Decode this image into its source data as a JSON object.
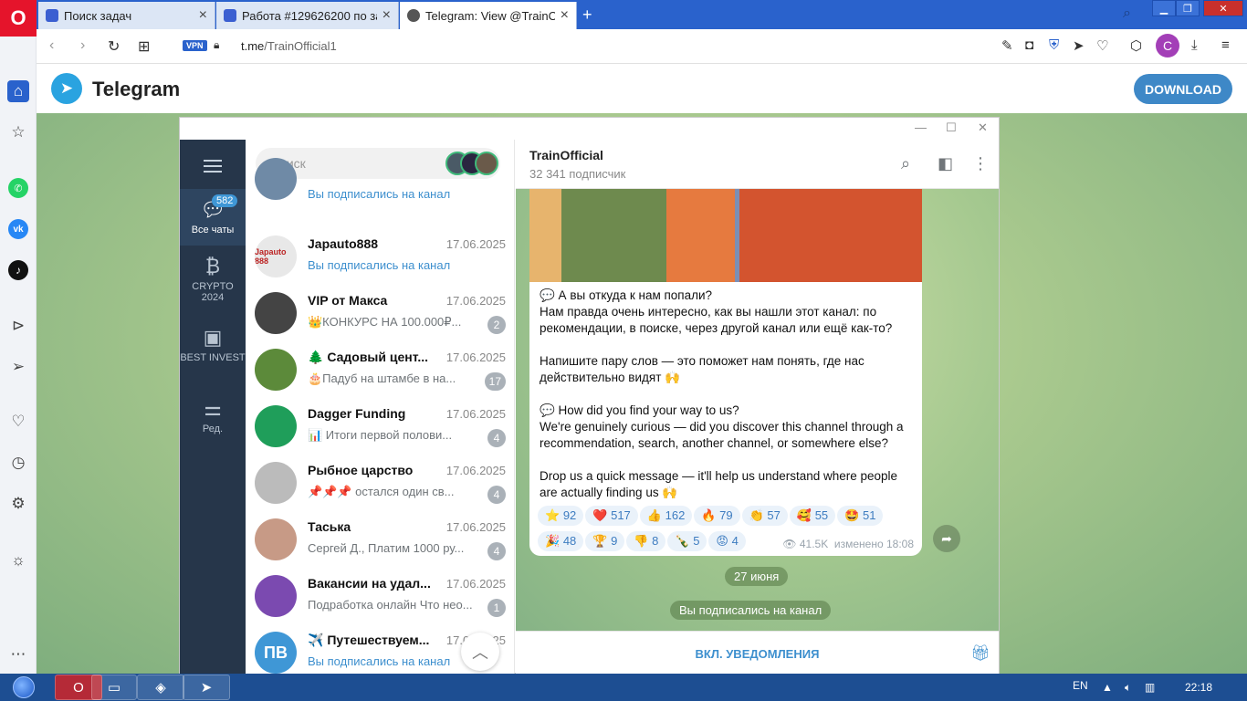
{
  "browser": {
    "tabs": [
      {
        "title": "Поиск задач",
        "active": false
      },
      {
        "title": "Работа #129626200 по зада",
        "active": false
      },
      {
        "title": "Telegram: View @TrainOffici",
        "active": true
      }
    ],
    "vpn_label": "VPN",
    "url_host": "t.me",
    "url_path": "/TrainOfficial1",
    "profile_initial": "C"
  },
  "site": {
    "brand": "Telegram",
    "download_label": "DOWNLOAD"
  },
  "app": {
    "folders": [
      {
        "label": "Все чаты",
        "badge": "582",
        "icon": "chat-bubbles-icon"
      },
      {
        "label": "CRYPTO 2024",
        "icon": "bitcoin-icon"
      },
      {
        "label": "BEST INVEST",
        "icon": "briefcase-icon"
      },
      {
        "label": "Ред.",
        "icon": "sliders-icon"
      }
    ],
    "search_placeholder": "Поиск",
    "chats": [
      {
        "name": "",
        "date": "",
        "preview": "Вы подписались на канал",
        "count": "",
        "avatar_text": "",
        "color": "#6f8aa6"
      },
      {
        "name": "Japauto888",
        "date": "17.06.2025",
        "preview": "Вы подписались на канал",
        "count": "",
        "avatar_text": "Japauto 888",
        "color": "#e8e8e8"
      },
      {
        "name": "VIP от Макса",
        "date": "17.06.2025",
        "preview": "👑КОНКУРС НА 100.000₽...",
        "count": "2",
        "avatar_text": "",
        "color": "#444"
      },
      {
        "name": "🌲 Садовый цент...",
        "date": "17.06.2025",
        "preview": "🎂Падуб на штамбе в на...",
        "count": "17",
        "avatar_text": "",
        "color": "#5c8a3a"
      },
      {
        "name": "Dagger Funding",
        "date": "17.06.2025",
        "preview": "📊 Итоги первой полови...",
        "count": "4",
        "avatar_text": "",
        "color": "#1f9e5a"
      },
      {
        "name": "Рыбное царство",
        "date": "17.06.2025",
        "preview": "📌📌📌 остался один св...",
        "count": "4",
        "avatar_text": "",
        "color": "#bbb"
      },
      {
        "name": "Таська",
        "date": "17.06.2025",
        "preview": "Сергей Д., Платим 1000 ру...",
        "count": "4",
        "avatar_text": "",
        "color": "#c79a86"
      },
      {
        "name": "Вакансии на удал...",
        "date": "17.06.2025",
        "preview": "Подработка онлайн  Что нео...",
        "count": "1",
        "avatar_text": "",
        "color": "#7b4ab0"
      },
      {
        "name": "✈️ Путешествуем...",
        "date": "17.06.2025",
        "preview": "Вы подписались на канал",
        "count": "",
        "avatar_text": "ПВ",
        "color": "#3f97d6"
      }
    ],
    "channel": {
      "title": "TrainOfficial",
      "subscribers": "32 341 подписчик",
      "message_paragraphs": [
        "💬 А вы откуда к нам попали?\nНам правда очень интересно, как вы нашли этот канал: по рекомендации, в поиске, через другой канал или ещё как-то?",
        "Напишите пару слов — это поможет нам понять, где нас действительно видят 🙌",
        "💬 How did you find your way to us?\nWe're genuinely curious — did you discover this channel through a recommendation, search, another channel, or somewhere else?",
        "Drop us a quick message — it'll help us understand where people are actually finding us 🙌"
      ],
      "reactions": [
        {
          "emoji": "⭐",
          "count": "92"
        },
        {
          "emoji": "❤️",
          "count": "517"
        },
        {
          "emoji": "👍",
          "count": "162"
        },
        {
          "emoji": "🔥",
          "count": "79"
        },
        {
          "emoji": "👏",
          "count": "57"
        },
        {
          "emoji": "🥰",
          "count": "55"
        },
        {
          "emoji": "🤩",
          "count": "51"
        },
        {
          "emoji": "🎉",
          "count": "48"
        },
        {
          "emoji": "🏆",
          "count": "9"
        },
        {
          "emoji": "👎",
          "count": "8"
        },
        {
          "emoji": "🍾",
          "count": "5"
        },
        {
          "emoji": "😡",
          "count": "4"
        }
      ],
      "views": "41.5K",
      "edited": "изменено 18:08",
      "date_pill": "27 июня",
      "service_msg": "Вы подписались на канал",
      "notif_button": "ВКЛ. УВЕДОМЛЕНИЯ"
    }
  },
  "taskbar": {
    "lang": "EN",
    "time": "22:18"
  }
}
